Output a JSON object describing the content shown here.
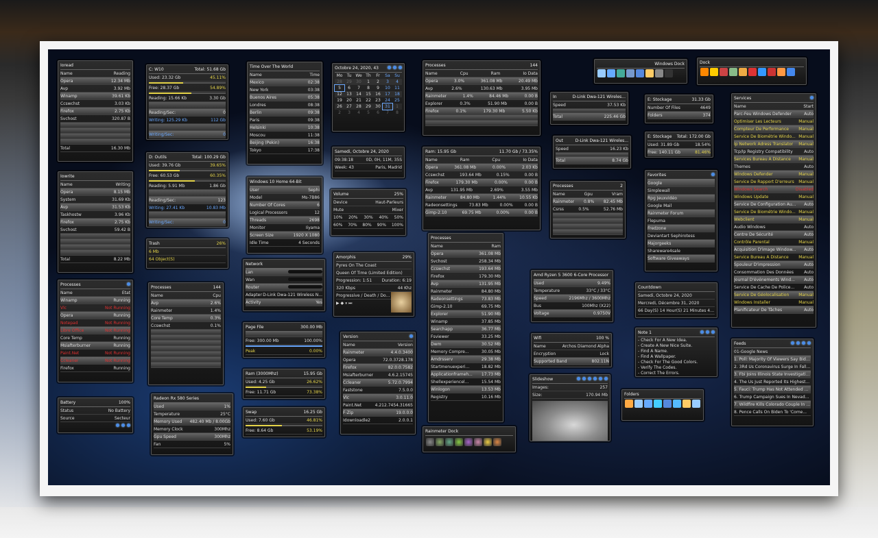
{
  "ioread": {
    "title": "Ioread",
    "head": [
      "Name",
      "Reading"
    ],
    "rows": [
      [
        "Opera",
        "12.34 Mb"
      ],
      [
        "Avp",
        "3.92 Mb"
      ],
      [
        "Winamp",
        "39.61 Kb"
      ],
      [
        "Ccswchst",
        "3.03 Kb"
      ],
      [
        "Firefox",
        "2.75 Kb"
      ],
      [
        "Svchost",
        "320.87 B"
      ]
    ],
    "total": [
      "Total",
      "16.30 Mb"
    ]
  },
  "iowrite": {
    "title": "Iowrite",
    "head": [
      "Name",
      "Writing"
    ],
    "rows": [
      [
        "Opera",
        "8.15 Mb"
      ],
      [
        "System",
        "31.69 Kb"
      ],
      [
        "Avp",
        "31.53 Kb"
      ],
      [
        "Taskhostw",
        "3.96 Kb"
      ],
      [
        "Firefox",
        "2.75 Kb"
      ],
      [
        "Svchost",
        "59.42 B"
      ]
    ],
    "total": [
      "Total",
      "8.22 Mb"
    ]
  },
  "procs_status": {
    "title": "Processes",
    "head": [
      "Name",
      "Etat"
    ],
    "rows": [
      [
        "Winamp",
        "Running",
        "n"
      ],
      [
        "Vlc",
        "Not Running",
        "r"
      ],
      [
        "Opera",
        "Running",
        "n"
      ],
      [
        "Notepad",
        "Not Running",
        "r"
      ],
      [
        "Libre Office",
        "Not Running",
        "r"
      ],
      [
        "Core Temp",
        "Running",
        "n"
      ],
      [
        "Msiafterburner",
        "Running",
        "n"
      ],
      [
        "Paint.Net",
        "Not Running",
        "r"
      ],
      [
        "Ccleaner",
        "Not Running",
        "r"
      ],
      [
        "Firefox",
        "Running",
        "n"
      ]
    ]
  },
  "battery": {
    "title": "Battery",
    "pct": "100%",
    "status_label": "Status",
    "status": "No Battery",
    "source_label": "Source",
    "source": "Secteur"
  },
  "cw10": {
    "title": "C: W10",
    "total": "Total: 51.68 Gb",
    "used": "Used: 23.32 Gb",
    "used_pct": "45.11%",
    "free": "Free: 28.37 Gb",
    "free_pct": "54.89%",
    "reading": "Reading: 15.66 Kb",
    "reading_val": "3.30 Gb",
    "reading_sec": "Reading/Sec:",
    "reading_sec_val": "0",
    "writing": "Writing: 125.29 Kb",
    "writing_val": "112 Gb",
    "writing_sec": "Writing/Sec:",
    "writing_sec_val": "0"
  },
  "doutils": {
    "title": "D: Outils",
    "total": "Total: 100.29 Gb",
    "used": "Used: 39.76 Gb",
    "used_pct": "39.65%",
    "free": "Free: 60.53 Gb",
    "free_pct": "60.35%",
    "reading": "Reading: 5.91 Mb",
    "reading_val": "1.86 Gb",
    "reading_sec": "Reading/Sec:",
    "reading_sec_val": "123",
    "writing": "Writing: 27.41 Kb",
    "writing_val": "10.83 Mb",
    "writing_sec": "Writing/Sec:",
    "writing_sec_val": "0"
  },
  "trash": {
    "title": "Trash",
    "pct": "26%",
    "size": "6 Mb",
    "objects": "64 Object(S)"
  },
  "procs_cpu": {
    "title": "Processes",
    "count": "144",
    "head": [
      "Name",
      "Cpu"
    ],
    "rows": [
      [
        "Avp",
        "2.6%"
      ],
      [
        "Rainmeter",
        "1.4%"
      ],
      [
        "Core Temp",
        "0.3%"
      ],
      [
        "Ccswchst",
        "0.1%"
      ]
    ]
  },
  "radeon": {
    "title": "Radeon Rx 580 Series",
    "rows": [
      [
        "Used",
        "1%"
      ],
      [
        "Temperature",
        "25°C"
      ],
      [
        "Memory Used",
        "482.40 Mb / 8.00Gb"
      ],
      [
        "Memory Clock",
        "300Mhz"
      ],
      [
        "Gpu Speed",
        "300Mhz"
      ],
      [
        "Fan",
        "5%"
      ]
    ]
  },
  "timeworld": {
    "title": "Time Over The World",
    "head": [
      "Name",
      "Time"
    ],
    "rows": [
      [
        "Mexico",
        "02:38"
      ],
      [
        "New York",
        "03:38"
      ],
      [
        "Buenos Aires",
        "05:38"
      ],
      [
        "Londres",
        "08:38"
      ],
      [
        "Berlin",
        "09:38"
      ],
      [
        "Paris",
        "09:38"
      ],
      [
        "Helsinki",
        "10:38"
      ],
      [
        "Moscou",
        "11:38"
      ],
      [
        "Beijing (Pekin)",
        "16:38"
      ],
      [
        "Tokyo",
        "17:38"
      ]
    ]
  },
  "win10": {
    "title": "Windows 10 Home 64-Bit",
    "rows": [
      [
        "User",
        "Sephi"
      ],
      [
        "Model",
        "Ms-7B86"
      ],
      [
        "Number Of Cores",
        "6"
      ],
      [
        "Logical Processors",
        "12"
      ],
      [
        "Threads",
        "2698"
      ],
      [
        "Monitor",
        "Iiyama"
      ],
      [
        "Screen Size",
        "1920 X 1080"
      ],
      [
        "Idle Time",
        "4 Seconds"
      ]
    ]
  },
  "network": {
    "title": "Network",
    "rows": [
      [
        "Lan",
        ""
      ],
      [
        "Wan",
        ""
      ],
      [
        "Router",
        ""
      ],
      [
        "Adapter",
        "D-Link Dwa-121 Wireless N..."
      ],
      [
        "Activity",
        "Yes"
      ]
    ]
  },
  "pagefile": {
    "title": "Page File",
    "total": "300.00 Mb",
    "free": "Free: 300.00 Mb",
    "free_pct": "100.00%",
    "peak": "Peak",
    "peak_pct": "0.00%"
  },
  "ram3000": {
    "title": "Ram (3000Mhz)",
    "total": "15.95 Gb",
    "used": "Used: 4.25 Gb",
    "used_pct": "26.62%",
    "free": "Free: 11.71 Gb",
    "free_pct": "73.38%"
  },
  "swap": {
    "title": "Swap",
    "total": "16.25 Gb",
    "used": "Used: 7.60 Gb",
    "used_pct": "46.81%",
    "free": "Free: 8.64 Gb",
    "free_pct": "53.19%"
  },
  "calendar": {
    "title": "Octobre 24, 2020, 43",
    "days": [
      "Mo",
      "Tu",
      "We",
      "Th",
      "Fr",
      "Sa",
      "Su"
    ],
    "cells": [
      "28",
      "29",
      "30",
      "1",
      "2",
      "3",
      "4",
      "5",
      "6",
      "7",
      "8",
      "9",
      "10",
      "11",
      "12",
      "13",
      "14",
      "15",
      "16",
      "17",
      "18",
      "19",
      "20",
      "21",
      "22",
      "23",
      "24",
      "25",
      "26",
      "27",
      "28",
      "29",
      "30",
      "31",
      "1",
      "2",
      "3",
      "4",
      "5",
      "6",
      "7",
      "8"
    ]
  },
  "clock": {
    "title": "Samedi, Octobre 24, 2020",
    "time": "09:38:18",
    "uptime": "0D, 0H, 11M, 35S",
    "week": "Week: 43",
    "zone": "Paris, Madrid"
  },
  "volume": {
    "title": "Volume",
    "pct": "25%",
    "device_label": "Device",
    "device": "Haut-Parleurs",
    "mute": "Mute",
    "mixer": "Mixer",
    "levels1": [
      "10%",
      "20%",
      "30%",
      "40%",
      "50%"
    ],
    "levels2": [
      "60%",
      "70%",
      "80%",
      "90%",
      "100%"
    ]
  },
  "amorphis": {
    "title": "Amorphis",
    "pct": "29%",
    "track": "Pyres On The Coast",
    "album": "Queen Of Time (Limited Edition)",
    "progress": "Progression: 1:51",
    "duration": "Duration: 6:19",
    "bitrate": "320 Kbps",
    "freq": "44 Khz",
    "genre": "Progressive / Death / Doom..."
  },
  "version": {
    "title": "Version",
    "head": [
      "Name",
      "Version"
    ],
    "rows": [
      [
        "Rainmeter",
        "4.4.0.3400"
      ],
      [
        "Opera",
        "72.0.3728.178"
      ],
      [
        "Firefox",
        "82.0.0.7582"
      ],
      [
        "Msiafterburner",
        "4.6.2.15745"
      ],
      [
        "Ccleaner",
        "5.72.0.7994"
      ],
      [
        "Faststone",
        "7.5.0.0"
      ],
      [
        "Vlc",
        "3.0.11.0"
      ],
      [
        "Paint.Net",
        "4.212.7454.31665"
      ],
      [
        "F-Zip",
        "19.0.0.0"
      ],
      [
        "Idownloadle2",
        "2.0.0.1"
      ]
    ]
  },
  "procs_top": {
    "title": "Processes",
    "count": "144",
    "head": [
      "Name",
      "Cpu",
      "Ram",
      "Io Data"
    ],
    "rows": [
      [
        "Opera",
        "3.0%",
        "361.08 Mb",
        "20.49 Mb"
      ],
      [
        "Avp",
        "2.6%",
        "130.63 Mb",
        "3.95 Mb"
      ],
      [
        "Rainmeter",
        "1.4%",
        "84.46 Mb",
        "0.00 B"
      ],
      [
        "Explorer",
        "0.3%",
        "51.90 Mb",
        "0.00 B"
      ],
      [
        "Firefox",
        "0.1%",
        "179.30 Mb",
        "5.50 Kb"
      ]
    ]
  },
  "ram_procs": {
    "title": "Ram: 15.95 Gb",
    "sub": "11.70 Gb / 73.35%",
    "head": [
      "Name",
      "Ram",
      "Cpu",
      "Io Data"
    ],
    "rows": [
      [
        "Opera",
        "361.08 Mb",
        "0.00%",
        "2.03 Kb"
      ],
      [
        "Ccswchst",
        "193.64 Mb",
        "0.15%",
        "0.00 B"
      ],
      [
        "Firefox",
        "179.30 Mb",
        "0.00%",
        "0.00 B"
      ],
      [
        "Avp",
        "131.95 Mb",
        "2.69%",
        "3.55 Mb"
      ],
      [
        "Rainmeter",
        "84.80 Mb",
        "1.44%",
        "10.55 Kb"
      ],
      [
        "Radeonsettings",
        "73.83 Mb",
        "0.00%",
        "0.00 B"
      ],
      [
        "Gimp-2.10",
        "69.75 Mb",
        "0.00%",
        "0.00 B"
      ]
    ]
  },
  "procs_ram": {
    "title": "Processes",
    "head": [
      "Name",
      "Ram"
    ],
    "rows": [
      [
        "Opera",
        "361.08 Mb"
      ],
      [
        "Svchost",
        "258.34 Mb"
      ],
      [
        "Ccswchst",
        "193.64 Mb"
      ],
      [
        "Firefox",
        "179.30 Mb"
      ],
      [
        "Avp",
        "131.95 Mb"
      ],
      [
        "Rainmeter",
        "84.80 Mb"
      ],
      [
        "Radeonsettings",
        "73.83 Mb"
      ],
      [
        "Gimp-2.10",
        "69.75 Mb"
      ],
      [
        "Explorer",
        "51.90 Mb"
      ],
      [
        "Winamp",
        "37.85 Mb"
      ],
      [
        "Searchapp",
        "36.77 Mb"
      ],
      [
        "Fsviewer",
        "33.25 Mb"
      ],
      [
        "Dwm",
        "30.52 Mb"
      ],
      [
        "Memory Compre...",
        "30.05 Mb"
      ],
      [
        "Amdrsserv",
        "29.38 Mb"
      ],
      [
        "Startmenuexperi...",
        "18.82 Mb"
      ],
      [
        "Applicationframeh...",
        "17.73 Mb"
      ],
      [
        "Shellexperiencel...",
        "15.54 Mb"
      ],
      [
        "Winlogon",
        "13.53 Mb"
      ],
      [
        "Registry",
        "10.16 Mb"
      ]
    ]
  },
  "rdock": {
    "title": "Rainmeter Dock"
  },
  "wdock": {
    "title": "Windows Dock"
  },
  "dlink1": {
    "title": "In",
    "adapter": "D-Link Dwa-121 Wireles...",
    "speed_label": "Speed",
    "speed": "37.53 Kb",
    "total_label": "Total",
    "total": "225.46 Gb"
  },
  "dlink2": {
    "title": "Out",
    "adapter": "D-Link Dwa-121 Wireles...",
    "speed_label": "Speed",
    "speed": "16.23 Kb",
    "total_label": "Total",
    "total": "8.74 Gb"
  },
  "gpu_procs": {
    "title": "Processes",
    "count": "2",
    "head": [
      "Name",
      "Gpu",
      "Vram"
    ],
    "rows": [
      [
        "Rainmeter",
        "0.8%",
        "82.45 Mb"
      ],
      [
        "Csrss",
        "0.5%",
        "52.76 Mb"
      ]
    ]
  },
  "amd": {
    "title": "Amd Ryzen 5 3600 6-Core Processor",
    "rows": [
      [
        "Used",
        "9.49%"
      ],
      [
        "Temperature",
        "33°C / 33°C"
      ],
      [
        "Speed",
        "2196Mhz / 3600Mhz"
      ],
      [
        "Bus",
        "100Mhz (X22)"
      ],
      [
        "Voltage",
        "0.9750V"
      ]
    ]
  },
  "wifi": {
    "title": "Wifi",
    "pct": "100 %",
    "name_label": "Name",
    "name": "Archos Diamond Alpha",
    "enc_label": "Encryption",
    "enc": "Lock",
    "band_label": "Supported Band",
    "band": "802.11N"
  },
  "slideshow": {
    "title": "Slideshow",
    "images_label": "Images:",
    "images": "257",
    "size_label": "Size:",
    "size": "170.94 Mb"
  },
  "estock1": {
    "title": "E: Stockage",
    "total": "31.33 Gb",
    "files_label": "Number Of Files",
    "files": "4649",
    "folders_label": "Folders",
    "folders": "374"
  },
  "estock2": {
    "title": "E: Stockage",
    "total": "Total: 172.00 Gb",
    "used": "Used: 31.89 Gb",
    "used_pct": "18.54%",
    "free": "Free: 140.11 Gb",
    "free_pct": "81.46%"
  },
  "favorites": {
    "title": "Favorites",
    "items": [
      "Google",
      "Simplewall",
      "Rpg Jeuxvidéo",
      "Google Mail",
      "Rainmeter Forum",
      "Flepuma",
      "Fredzone",
      "Deviantart Sephirotess",
      "Majorgeeks",
      "Shareware4sale",
      "Software Giveaways"
    ]
  },
  "countdown": {
    "title": "Countdown",
    "l1": "Samedi, Octobre 24, 2020",
    "l2": "Mercredi, Décembre 31, 2020",
    "l3": "66 Day(S) 14 Hour(S) 21 Minutes 42 Seconds"
  },
  "note": {
    "title": "Note 1",
    "lines": [
      "- Check For A New Idea.",
      "- Create A New Nice Suite.",
      "- Find A Name.",
      "- Find A Wallpaper.",
      "- Check For The Good Colors.",
      "- Verify The Codes.",
      "- Correct The Errors."
    ]
  },
  "folders": {
    "title": "Folders"
  },
  "dock": {
    "title": "Dock"
  },
  "services": {
    "title": "Services",
    "head": [
      "Name",
      "Start"
    ],
    "rows": [
      [
        "Parc-Feu Windows Defender",
        "Auto",
        "n"
      ],
      [
        "Optimiser Les Lecteurs",
        "Manual",
        "y"
      ],
      [
        "Compteur De Performance",
        "Manual",
        "y"
      ],
      [
        "Service De Biométrie Windo...",
        "Manual",
        "y"
      ],
      [
        "Ip Network Adress Translator",
        "Manual",
        "y"
      ],
      [
        "Tcp/Ip Registry Compatibility",
        "Auto",
        "n"
      ],
      [
        "Services Bureau À Distance",
        "Manual",
        "y"
      ],
      [
        "Themes",
        "Auto",
        "n"
      ],
      [
        "Windows Defender",
        "Manual",
        "y"
      ],
      [
        "Service De Rapport D'erreurs",
        "Manual",
        "y"
      ],
      [
        "Windows Search",
        "Disabled",
        "r"
      ],
      [
        "Windows Update",
        "Manual",
        "y"
      ],
      [
        "Service De Configuration Au...",
        "Auto",
        "n"
      ],
      [
        "Service De Biométrie Windo...",
        "Manual",
        "y"
      ],
      [
        "Webclient",
        "Manual",
        "y"
      ],
      [
        "Audio Windows",
        "Auto",
        "n"
      ],
      [
        "Centre De Sécurité",
        "Auto",
        "n"
      ],
      [
        "Contrôle Parental",
        "Manual",
        "y"
      ],
      [
        "Acquisition D'image Window...",
        "Auto",
        "n"
      ],
      [
        "Service Bureau À Distance",
        "Manual",
        "y"
      ],
      [
        "Spouleur D'impression",
        "Auto",
        "n"
      ],
      [
        "Consommation Des Données",
        "Auto",
        "n"
      ],
      [
        "Journal D'événements Wind...",
        "Auto",
        "n"
      ],
      [
        "Service De Cache De Police...",
        "Auto",
        "n"
      ],
      [
        "Service De Géolocalisation",
        "Manual",
        "y"
      ],
      [
        "Windows Installer",
        "Manual",
        "y"
      ],
      [
        "Planificateur De Tâches",
        "Auto",
        "n"
      ]
    ]
  },
  "feeds": {
    "title": "Feeds",
    "source": "01-Google News",
    "items": [
      "1. Poll: Majority Of Viewers Say Biden W...",
      "2. 3Rd Us Coronavirus Surge In Fall Arri...",
      "3. Fbi Joins Illinois State Investigation...",
      "4. The Us Just Reported Its Highest...",
      "5. Fauci: Trump Has Not Attended A...",
      "6. Trump Campaign Sues In Nevada To...",
      "7. Wildfire Kills Colorado Couple In Thei...",
      "8. Pence Calls On Biden To 'Come..."
    ]
  },
  "colors": {
    "accent": "#e6d54a",
    "danger": "#e03030",
    "link": "#4a8ce8"
  }
}
